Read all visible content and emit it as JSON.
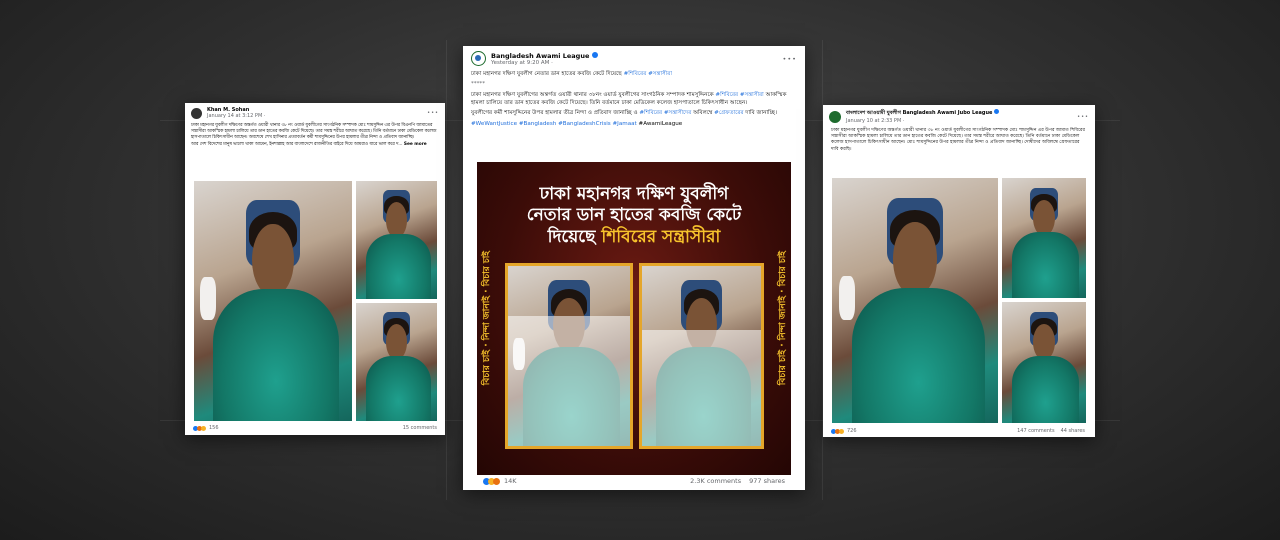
{
  "colors": {
    "background": "#2f2f2f",
    "link": "#216fdb",
    "graphic_bg": "#3b0c08",
    "graphic_highlight": "#f7c32c",
    "frame_gold": "#e5a62a",
    "awami_green": "#1e6b2e"
  },
  "left_post": {
    "author": "Khan M. Sohan",
    "time": "January 14 at 3:12 PM ·",
    "text": "ঢাকা মহানগর যুবলীগ দক্ষিণের অন্তর্গত ওয়ারী থানার ৩৮ নং ওয়ার্ড যুবলীগের সাংগঠনিক সম্পাদক মোঃ শামসুদ্দিন এর উপর বিএনপি জামাতের সন্ত্রাসীরা আকস্মিক হামলা চালিয়ে তার ডান হাতের কবজি কেটে দিয়েছে। তার সমস্ত শরীরে আঘাত করেছে। তিনি বর্তমানে ঢাকা মেডিকেল কলেজ হাসপাতালে চিকিৎসাধীন আছেন। অবশেষে শেখ হাসিনার প্রত্যাবর্তন কর্মী শামসুদ্দিনের উপর হামলার তীব্র নিন্দা ও প্রতিবাদ জানাচ্ছি।",
    "text2": "আর দেশ বিদেশের মানুষ ভালো থাকা আমেন, ইনশাল্লাহ আর বাংলাদেশে রাজনীতির বাইরে দিয়ে আমরাও যারে ভাল করে দ...",
    "see_more": "See more",
    "reaction_count": "156",
    "comments": "15 comments"
  },
  "center_post": {
    "author": "Bangladesh Awami League",
    "time": "Yesterday at 9:20 AM ·",
    "headline": "ঢাকা মহানগর দক্ষিণ যুবলীগ নেতার ডান হাতের কবজি কেটে দিয়েছে ",
    "headline_tag": "#শিবিরের #সন্ত্রাসীরা",
    "dots": "*****",
    "para1_a": "ঢাকা মহানগর দক্ষিণ যুবলীগের অন্তর্গত ওয়ারী থানার ৩৮নং ওয়ার্ড যুবলীগের সাংগঠনিক সম্পাদক শামসুদ্দিনকে ",
    "para1_tag": "#শিবিরের #সন্ত্রাসীরা",
    "para1_b": " আকস্মিক হামলা চালিয়ে তার ডান হাতের কবজি কেটে দিয়েছে। তিনি বর্তমানে ঢাকা মেডিকেল কলেজ হাসপাতালে চিকিৎসাধীন আছেন।",
    "para2_a": "যুবলীগের কর্মী শামসুদ্দিনের উপর হামলার তীব্র নিন্দা ও প্রতিবাদ জানাচ্ছি ও ",
    "para2_tag": "#শিবিরের #সন্ত্রাসীদের",
    "para2_b": " অবিলম্বে ",
    "para2_tag2": "#গ্রেফতারের",
    "para2_c": " দাবি জানাচ্ছি।",
    "hashtags": "#WeWantJustice #Bangladesh #BangladeshCrisis #Jamaat",
    "hashtag_end": "#AwamiLeague",
    "graphic_line1": "ঢাকা মহানগর দক্ষিণ যুবলীগ",
    "graphic_line2": "নেতার ডান হাতের কবজি কেটে",
    "graphic_line3_a": "দিয়েছে ",
    "graphic_line3_b": "শিবিরের সন্ত্রাসীরা",
    "strip_text": "বিচার চাই · নিন্দা জানাই · বিচার চাই",
    "reaction_count": "14K",
    "comments": "2.3K comments",
    "shares": "977 shares"
  },
  "right_post": {
    "author": "বাংলাদেশ আওয়ামী যুবলীগ",
    "author_en": " Bangladesh Awami Jubo League",
    "time": "January 10 at 2:33 PM ·",
    "text": "ঢাকা মহানগর যুবলীগ দক্ষিণের অন্তর্গত ওয়ারী থানার ৩৮ নং ওয়ার্ড যুবলীগের সাংগঠনিক সম্পাদক মোঃ শামসুদ্দিন এর উপর জামাত শিবিরের সন্ত্রাসীরা আকস্মিক হামলা চালিয়ে তার ডান হাতের কবজি কেটে দিয়েছে। তার সমস্ত শরীরে আঘাত করেছে। তিনি বর্তমানে ঢাকা মেডিকেল কলেজ হাসপাতালে চিকিৎসাধীন আছেন। মোঃ শামসুদ্দিনের উপর হামলার তীব্র নিন্দা ও প্রতিবাদ জানাচ্ছি। দোষীদের অবিলম্বে গ্রেফতারের দাবি করছি।",
    "reaction_count": "726",
    "comments": "147 comments",
    "shares": "44 shares"
  }
}
